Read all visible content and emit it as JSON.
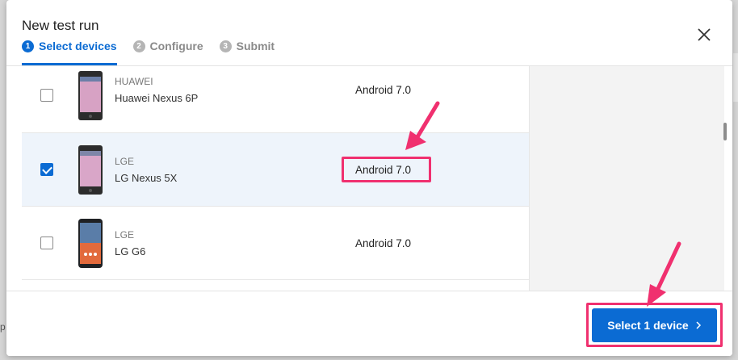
{
  "dialog": {
    "title": "New test run",
    "steps": [
      {
        "number": "1",
        "label": "Select devices",
        "state": "active"
      },
      {
        "number": "2",
        "label": "Configure",
        "state": "inactive"
      },
      {
        "number": "3",
        "label": "Submit",
        "state": "inactive"
      }
    ],
    "close_icon": "close-icon"
  },
  "devices": [
    {
      "maker": "HUAWEI",
      "model": "Huawei Nexus 6P",
      "os": "Android 7.0",
      "checked": false
    },
    {
      "maker": "LGE",
      "model": "LG Nexus 5X",
      "os": "Android 7.0",
      "checked": true
    },
    {
      "maker": "LGE",
      "model": "LG G6",
      "os": "Android 7.0",
      "checked": false
    }
  ],
  "footer": {
    "primary_label": "Select 1 device",
    "chevron_icon": "chevron-right-icon"
  },
  "colors": {
    "accent": "#0b6bd3",
    "annotation": "#f0306f",
    "selected_row": "#eef4fb"
  }
}
